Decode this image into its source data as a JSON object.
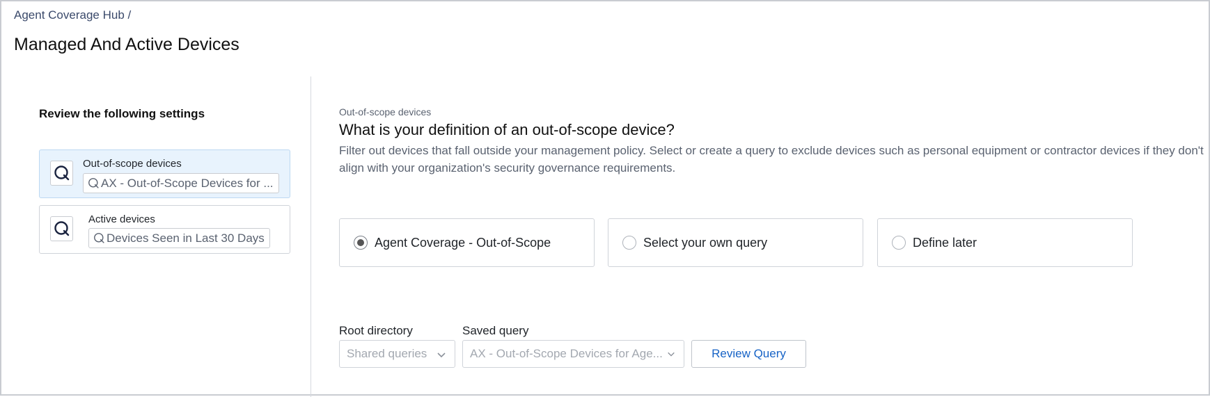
{
  "breadcrumb": "Agent Coverage Hub /",
  "page_title": "Managed And Active Devices",
  "left_panel": {
    "heading": "Review the following settings",
    "cards": [
      {
        "label": "Out-of-scope devices",
        "query": "AX - Out-of-Scope Devices for ...",
        "icon": "query-icon",
        "selected": true
      },
      {
        "label": "Active devices",
        "query": "Devices Seen in Last 30 Days",
        "icon": "query-icon",
        "selected": false
      }
    ]
  },
  "main": {
    "section_label": "Out-of-scope devices",
    "question": "What is your definition of an out-of-scope device?",
    "description": "Filter out devices that fall outside your management policy. Select or create a query to exclude devices such as personal equipment or contractor devices if they don't align with your organization's security governance requirements.",
    "options": [
      {
        "label": "Agent Coverage - Out-of-Scope",
        "checked": true
      },
      {
        "label": "Select your own query",
        "checked": false
      },
      {
        "label": "Define later",
        "checked": false
      }
    ],
    "root_directory": {
      "label": "Root directory",
      "value": "Shared queries"
    },
    "saved_query": {
      "label": "Saved query",
      "value": "AX - Out-of-Scope Devices for Age..."
    },
    "review_button": "Review Query"
  },
  "colors": {
    "accent_link": "#1763c6",
    "selected_card_bg": "#e8f3fd"
  }
}
